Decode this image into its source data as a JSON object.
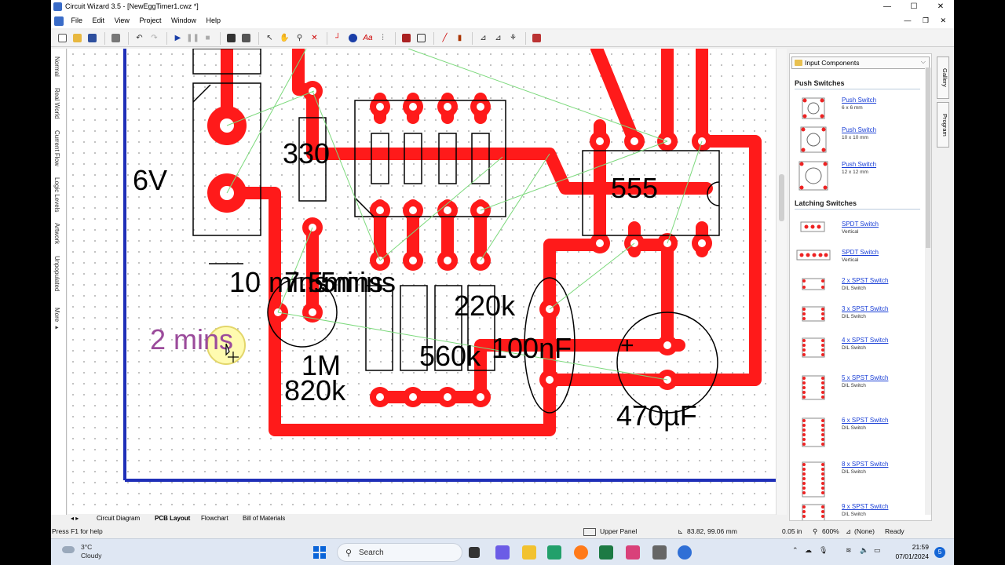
{
  "window": {
    "title": "Circuit Wizard 3.5 - [NewEggTimer1.cwz *]",
    "controls": [
      "—",
      "☐",
      "✕"
    ]
  },
  "menu": [
    "File",
    "Edit",
    "View",
    "Project",
    "Window",
    "Help"
  ],
  "mdi_controls": "— ❐ ✕",
  "side_tabs": [
    "Normal",
    "Real World",
    "Current Flow",
    "Logic Levels",
    "Artwork",
    "Unpopulated",
    "More ▸"
  ],
  "pcb": {
    "labels": {
      "supply": "6V",
      "r330": "330",
      "ic": "555",
      "overlap": "10 mins",
      "overlap2": "7.5mins",
      "overlap3": "5mins",
      "active_label": "2 mins",
      "r1m": "1M",
      "r820k": "820k",
      "r220k": "220k",
      "r560k": "560k",
      "c100n": "100nF",
      "c470u": "470µF",
      "plus": "+"
    },
    "colors": {
      "track": "#ff1a1a",
      "board_edge": "#1f2fb8",
      "ratsnest": "#7cd97c",
      "label": "#000000",
      "highlight_label": "#9b4b9b"
    }
  },
  "panel": {
    "dropdown": "Input Components",
    "sections": [
      {
        "title": "Push Switches",
        "items": [
          {
            "name": "Push Switch",
            "sub": "6 x 6 mm"
          },
          {
            "name": "Push Switch",
            "sub": "10 x 10 mm"
          },
          {
            "name": "Push Switch",
            "sub": "12 x 12 mm"
          }
        ]
      },
      {
        "title": "Latching Switches",
        "items": [
          {
            "name": "SPDT Switch",
            "sub": "Vertical"
          },
          {
            "name": "SPDT Switch",
            "sub": "Vertical"
          },
          {
            "name": "2 x SPST Switch",
            "sub": "DIL Switch"
          },
          {
            "name": "3 x SPST Switch",
            "sub": "DIL Switch"
          },
          {
            "name": "4 x SPST Switch",
            "sub": "DIL Switch"
          },
          {
            "name": "5 x SPST Switch",
            "sub": "DIL Switch"
          },
          {
            "name": "6 x SPST Switch",
            "sub": "DIL Switch"
          },
          {
            "name": "8 x SPST Switch",
            "sub": "DIL Switch"
          },
          {
            "name": "9 x SPST Switch",
            "sub": "DIL Switch"
          }
        ]
      }
    ],
    "vtabs": [
      "Gallery",
      "Program"
    ]
  },
  "bottom_tabs": [
    "Circuit Diagram",
    "PCB Layout",
    "Flowchart",
    "Bill of Materials"
  ],
  "status": {
    "help": "Press F1 for help",
    "layer": "Upper Panel",
    "coords": "83.82, 99.06 mm",
    "grid": "0.05 in",
    "zoom": "600%",
    "snap": "(None)",
    "state": "Ready"
  },
  "taskbar": {
    "temp": "3°C",
    "condition": "Cloudy",
    "search": "Search",
    "time": "21:59",
    "date": "07/01/2024",
    "notifications": "5"
  }
}
